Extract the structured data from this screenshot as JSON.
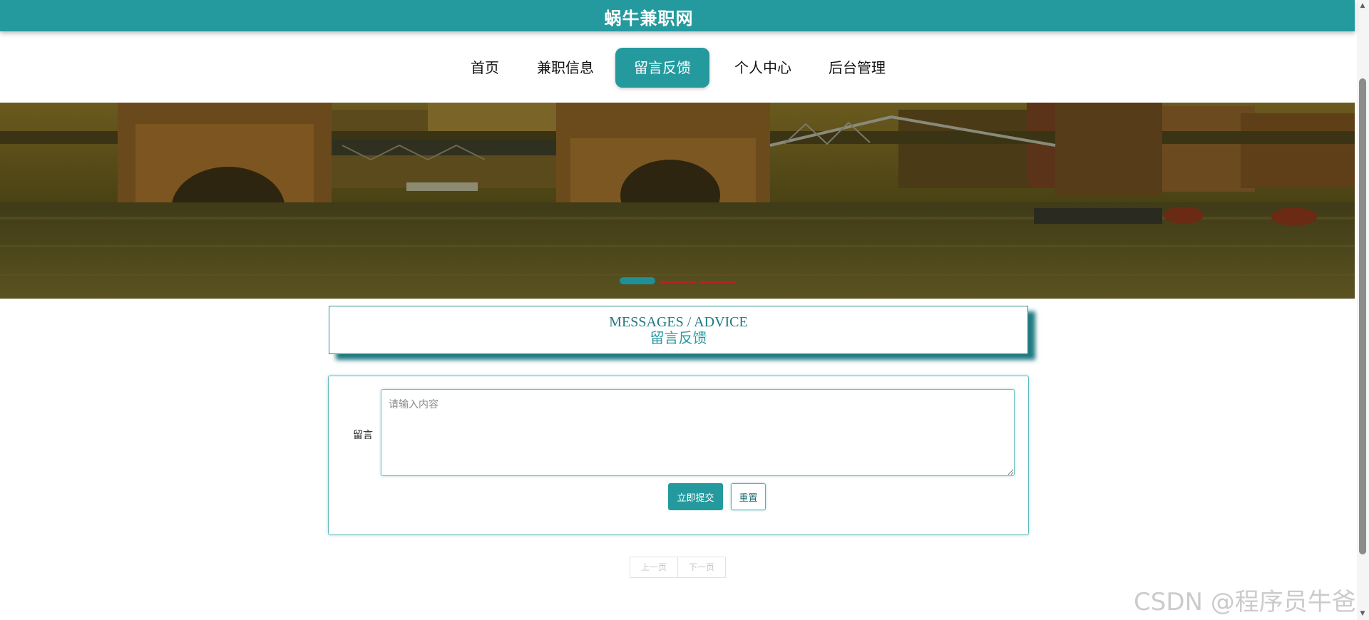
{
  "header": {
    "site_title": "蜗牛兼职网",
    "brand_color": "#259a9e"
  },
  "nav": {
    "items": [
      {
        "label": "首页",
        "active": false
      },
      {
        "label": "兼职信息",
        "active": false
      },
      {
        "label": "留言反馈",
        "active": true
      },
      {
        "label": "个人中心",
        "active": false
      },
      {
        "label": "后台管理",
        "active": false
      }
    ]
  },
  "banner": {
    "slide_count": 3,
    "active_slide": 1
  },
  "section": {
    "title_en": "MESSAGES / ADVICE",
    "title_cn": "留言反馈"
  },
  "form": {
    "message_label": "留言",
    "message_placeholder": "请输入内容",
    "message_value": "",
    "submit_label": "立即提交",
    "reset_label": "重置"
  },
  "pagination": {
    "prev_label": "上一页",
    "next_label": "下一页"
  },
  "watermark": "CSDN @程序员牛爸"
}
